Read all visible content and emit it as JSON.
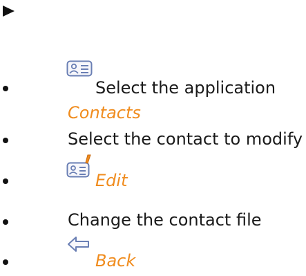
{
  "steps": [
    {
      "icon": "contacts-card-icon",
      "text": "Select the application",
      "link": "Contacts"
    },
    {
      "text": "Select the contact to modify"
    },
    {
      "icon": "edit-contact-icon",
      "link": "Edit"
    },
    {
      "text": "Change the contact file"
    },
    {
      "icon": "back-arrow-icon",
      "link": "Back"
    }
  ],
  "colors": {
    "accent": "#f08c1e",
    "icon_blue": "#6a7fb4",
    "text": "#1a1a1a"
  }
}
